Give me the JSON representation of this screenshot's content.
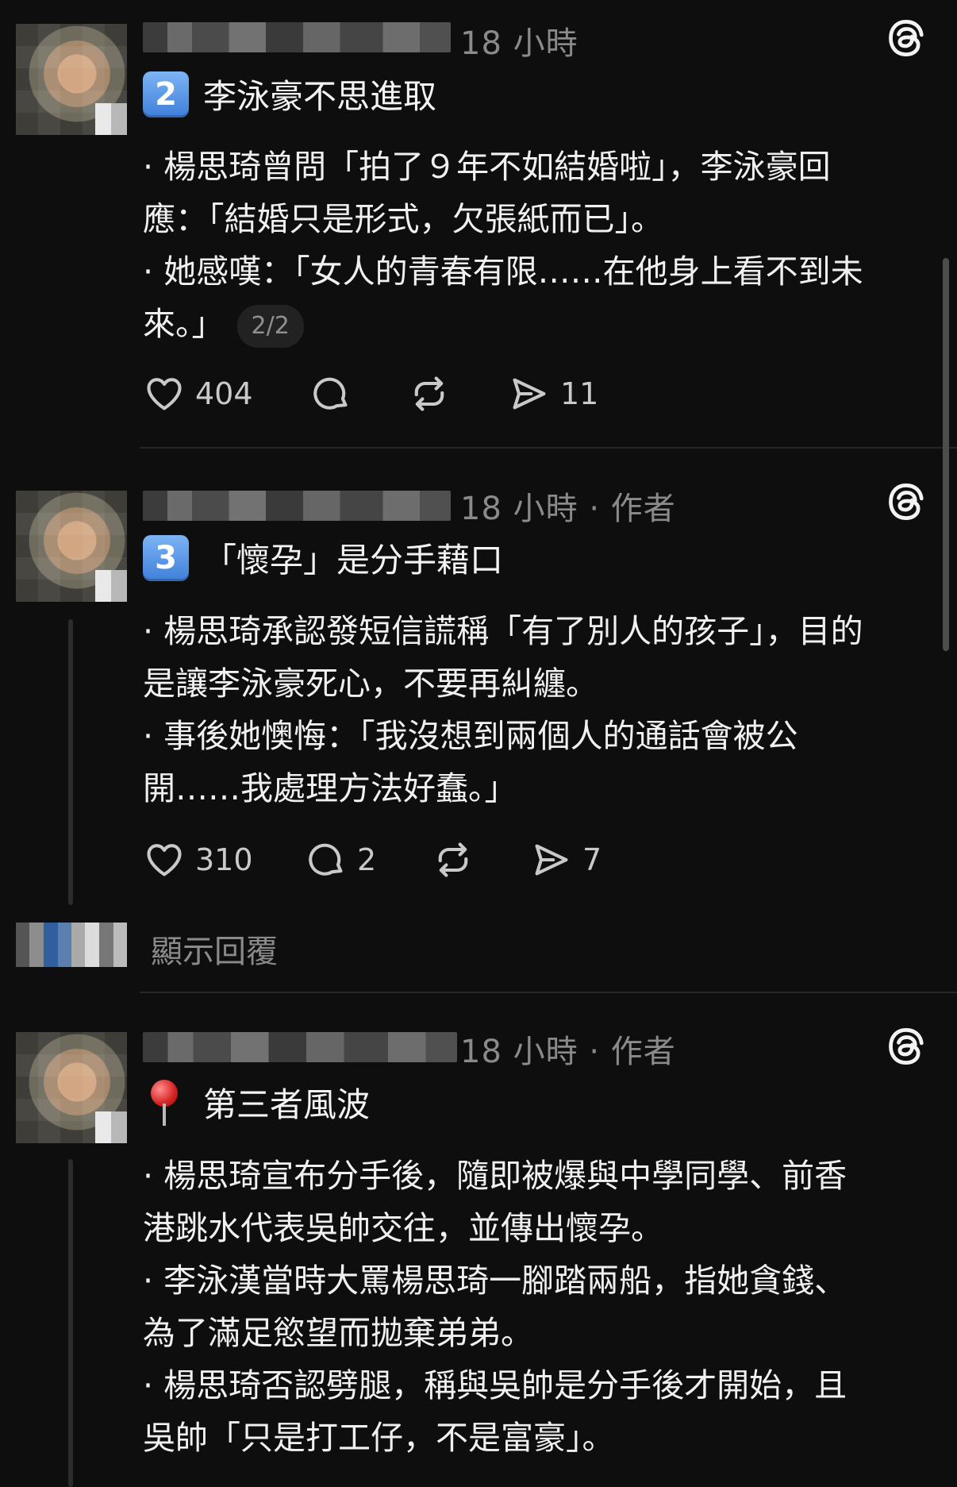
{
  "posts": [
    {
      "time": "18 小時",
      "author_tag": "",
      "title_emoji_number": "2",
      "title": "李泳豪不思進取",
      "lines": [
        "· 楊思琦曾問「拍了９年不如結婚啦」，李泳豪回",
        "應：「結婚只是形式，欠張紙而已」。",
        "· 她感嘆：「女人的青春有限……在他身上看不到未",
        "來。」"
      ],
      "pager": "2/2",
      "likes": "404",
      "comments": "",
      "shares": "11"
    },
    {
      "time": "18 小時",
      "author_tag": " · 作者",
      "title_emoji_number": "3",
      "title": "「懷孕」是分手藉口",
      "lines": [
        "· 楊思琦承認發短信謊稱「有了別人的孩子」，目的",
        "是讓李泳豪死心，不要再糾纏。",
        "· 事後她懊悔：「我沒想到兩個人的通話會被公",
        "開……我處理方法好蠢。」"
      ],
      "likes": "310",
      "comments": "2",
      "shares": "7"
    },
    {
      "time": "18 小時",
      "author_tag": " · 作者",
      "title": "第三者風波",
      "lines": [
        "· 楊思琦宣布分手後，隨即被爆與中學同學、前香",
        "港跳水代表吳帥交往，並傳出懷孕。",
        "· 李泳漢當時大罵楊思琦一腳踏兩船，指她貪錢、",
        "為了滿足慾望而拋棄弟弟。",
        "· 楊思琦否認劈腿，稱與吳帥是分手後才開始，且",
        "吳帥「只是打工仔，不是富豪」。"
      ]
    }
  ],
  "show_replies": "顯示回覆",
  "icons": {
    "threads": "threads-logo-icon",
    "heart": "heart-icon",
    "comment": "comment-bubble-icon",
    "repost": "repost-icon",
    "share": "send-icon",
    "pin": "round-pushpin-icon"
  },
  "colors": {
    "background": "#0e0e0e",
    "text": "#f3f3f3",
    "muted": "#8a8a8a",
    "keycap": "#3f7fd9"
  }
}
